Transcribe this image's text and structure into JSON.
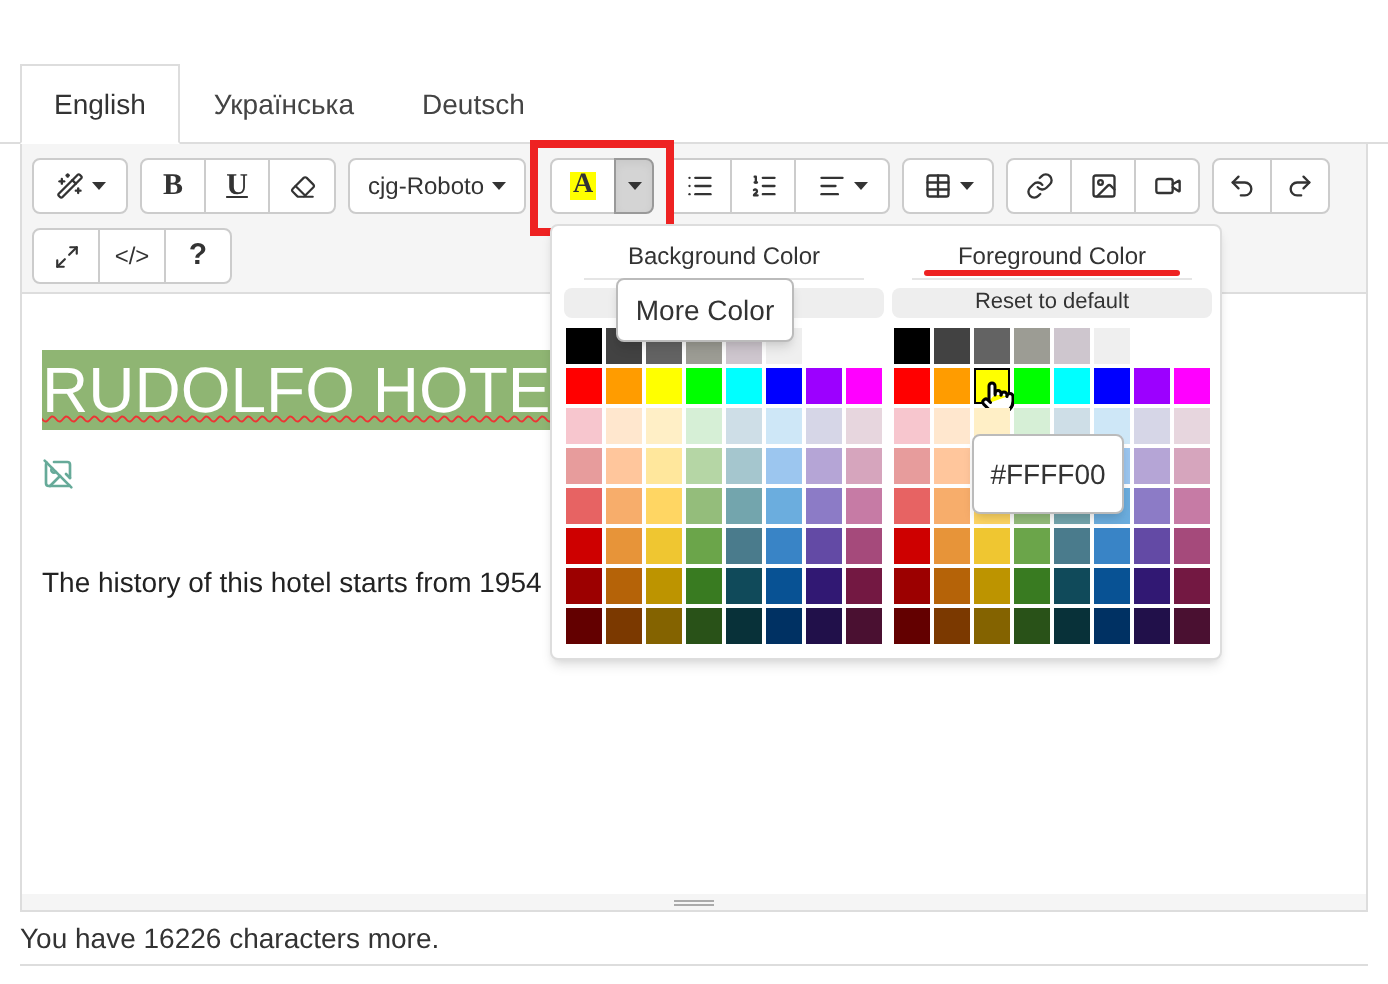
{
  "tabs": [
    {
      "label": "English",
      "selected": true
    },
    {
      "label": "Українська",
      "selected": false
    },
    {
      "label": "Deutsch",
      "selected": false
    }
  ],
  "toolbar": {
    "bold": "B",
    "underline": "U",
    "font": "cjg-Roboto",
    "color_letter": "A",
    "color_caret_pressed": true,
    "color_button_highlighted": true,
    "code_view": "</>",
    "help": "?"
  },
  "content": {
    "heading": "RUDOLFO HOTE",
    "paragraph": "The history of this hotel starts from 1954"
  },
  "color_picker": {
    "columns": [
      {
        "title": "Background Color",
        "annotated": false,
        "rows": [
          [
            {
              "color": "#000000",
              "hovered": false
            },
            {
              "color": "#424242",
              "hovered": false
            },
            {
              "color": "#636363",
              "hovered": false
            },
            {
              "color": "#9c9c94",
              "hovered": false
            },
            {
              "color": "#cec6ce",
              "hovered": false
            },
            {
              "color": "#efefef",
              "hovered": false
            },
            null,
            null
          ],
          [
            {
              "color": "#ff0000",
              "hovered": false
            },
            {
              "color": "#ff9c00",
              "hovered": false
            },
            {
              "color": "#ffff00",
              "hovered": false
            },
            {
              "color": "#00ff00",
              "hovered": false
            },
            {
              "color": "#00ffff",
              "hovered": false
            },
            {
              "color": "#0000ff",
              "hovered": false
            },
            {
              "color": "#9c00ff",
              "hovered": false
            },
            {
              "color": "#ff00ff",
              "hovered": false
            }
          ],
          [
            {
              "color": "#f7c6ce",
              "hovered": false
            },
            {
              "color": "#ffe7ce",
              "hovered": false
            },
            {
              "color": "#ffefc6",
              "hovered": false
            },
            {
              "color": "#d6efd6",
              "hovered": false
            },
            {
              "color": "#cedee7",
              "hovered": false
            },
            {
              "color": "#cee7f7",
              "hovered": false
            },
            {
              "color": "#d6d6e7",
              "hovered": false
            },
            {
              "color": "#e7d6de",
              "hovered": false
            }
          ],
          [
            {
              "color": "#e79c9c",
              "hovered": false
            },
            {
              "color": "#ffc69c",
              "hovered": false
            },
            {
              "color": "#ffe79c",
              "hovered": false
            },
            {
              "color": "#b5d6a5",
              "hovered": false
            },
            {
              "color": "#a5c6ce",
              "hovered": false
            },
            {
              "color": "#9cc6ef",
              "hovered": false
            },
            {
              "color": "#b5a5d6",
              "hovered": false
            },
            {
              "color": "#d6a5bd",
              "hovered": false
            }
          ],
          [
            {
              "color": "#e76363",
              "hovered": false
            },
            {
              "color": "#f7ad6b",
              "hovered": false
            },
            {
              "color": "#ffd663",
              "hovered": false
            },
            {
              "color": "#94bd7b",
              "hovered": false
            },
            {
              "color": "#73a5ad",
              "hovered": false
            },
            {
              "color": "#6badde",
              "hovered": false
            },
            {
              "color": "#8c7bc6",
              "hovered": false
            },
            {
              "color": "#c67ba5",
              "hovered": false
            }
          ],
          [
            {
              "color": "#ce0000",
              "hovered": false
            },
            {
              "color": "#e79439",
              "hovered": false
            },
            {
              "color": "#efc631",
              "hovered": false
            },
            {
              "color": "#6ba54a",
              "hovered": false
            },
            {
              "color": "#4a7b8c",
              "hovered": false
            },
            {
              "color": "#3984c6",
              "hovered": false
            },
            {
              "color": "#634aa5",
              "hovered": false
            },
            {
              "color": "#a54a7b",
              "hovered": false
            }
          ],
          [
            {
              "color": "#9c0000",
              "hovered": false
            },
            {
              "color": "#b56308",
              "hovered": false
            },
            {
              "color": "#bd9400",
              "hovered": false
            },
            {
              "color": "#397b21",
              "hovered": false
            },
            {
              "color": "#104a5a",
              "hovered": false
            },
            {
              "color": "#085294",
              "hovered": false
            },
            {
              "color": "#311873",
              "hovered": false
            },
            {
              "color": "#731842",
              "hovered": false
            }
          ],
          [
            {
              "color": "#630000",
              "hovered": false
            },
            {
              "color": "#7b3900",
              "hovered": false
            },
            {
              "color": "#846300",
              "hovered": false
            },
            {
              "color": "#295218",
              "hovered": false
            },
            {
              "color": "#083139",
              "hovered": false
            },
            {
              "color": "#003163",
              "hovered": false
            },
            {
              "color": "#21104a",
              "hovered": false
            },
            {
              "color": "#4a1031",
              "hovered": false
            }
          ]
        ]
      },
      {
        "title": "Foreground Color",
        "annotated": true,
        "reset_label": "Reset to default",
        "rows": [
          [
            {
              "color": "#000000",
              "hovered": false
            },
            {
              "color": "#424242",
              "hovered": false
            },
            {
              "color": "#636363",
              "hovered": false
            },
            {
              "color": "#9c9c94",
              "hovered": false
            },
            {
              "color": "#cec6ce",
              "hovered": false
            },
            {
              "color": "#efefef",
              "hovered": false
            },
            null,
            null
          ],
          [
            {
              "color": "#ff0000",
              "hovered": false
            },
            {
              "color": "#ff9c00",
              "hovered": false
            },
            {
              "color": "#ffff00",
              "hovered": true
            },
            {
              "color": "#00ff00",
              "hovered": false
            },
            {
              "color": "#00ffff",
              "hovered": false
            },
            {
              "color": "#0000ff",
              "hovered": false
            },
            {
              "color": "#9c00ff",
              "hovered": false
            },
            {
              "color": "#ff00ff",
              "hovered": false
            }
          ],
          [
            {
              "color": "#f7c6ce",
              "hovered": false
            },
            {
              "color": "#ffe7ce",
              "hovered": false
            },
            {
              "color": "#ffefc6",
              "hovered": false
            },
            {
              "color": "#d6efd6",
              "hovered": false
            },
            {
              "color": "#cedee7",
              "hovered": false
            },
            {
              "color": "#cee7f7",
              "hovered": false
            },
            {
              "color": "#d6d6e7",
              "hovered": false
            },
            {
              "color": "#e7d6de",
              "hovered": false
            }
          ],
          [
            {
              "color": "#e79c9c",
              "hovered": false
            },
            {
              "color": "#ffc69c",
              "hovered": false
            },
            null,
            null,
            null,
            {
              "color": "#9cc6ef",
              "hovered": false
            },
            {
              "color": "#b5a5d6",
              "hovered": false
            },
            {
              "color": "#d6a5bd",
              "hovered": false
            }
          ],
          [
            {
              "color": "#e76363",
              "hovered": false
            },
            {
              "color": "#f7ad6b",
              "hovered": false
            },
            {
              "color": "#ffd663",
              "hovered": false
            },
            {
              "color": "#94bd7b",
              "hovered": false
            },
            {
              "color": "#73a5ad",
              "hovered": false
            },
            {
              "color": "#6badde",
              "hovered": false
            },
            {
              "color": "#8c7bc6",
              "hovered": false
            },
            {
              "color": "#c67ba5",
              "hovered": false
            }
          ],
          [
            {
              "color": "#ce0000",
              "hovered": false
            },
            {
              "color": "#e79439",
              "hovered": false
            },
            {
              "color": "#efc631",
              "hovered": false
            },
            {
              "color": "#6ba54a",
              "hovered": false
            },
            {
              "color": "#4a7b8c",
              "hovered": false
            },
            {
              "color": "#3984c6",
              "hovered": false
            },
            {
              "color": "#634aa5",
              "hovered": false
            },
            {
              "color": "#a54a7b",
              "hovered": false
            }
          ],
          [
            {
              "color": "#9c0000",
              "hovered": false
            },
            {
              "color": "#b56308",
              "hovered": false
            },
            {
              "color": "#bd9400",
              "hovered": false
            },
            {
              "color": "#397b21",
              "hovered": false
            },
            {
              "color": "#104a5a",
              "hovered": false
            },
            {
              "color": "#085294",
              "hovered": false
            },
            {
              "color": "#311873",
              "hovered": false
            },
            {
              "color": "#731842",
              "hovered": false
            }
          ],
          [
            {
              "color": "#630000",
              "hovered": false
            },
            {
              "color": "#7b3900",
              "hovered": false
            },
            {
              "color": "#846300",
              "hovered": false
            },
            {
              "color": "#295218",
              "hovered": false
            },
            {
              "color": "#083139",
              "hovered": false
            },
            {
              "color": "#003163",
              "hovered": false
            },
            {
              "color": "#21104a",
              "hovered": false
            },
            {
              "color": "#4a1031",
              "hovered": false
            }
          ]
        ]
      }
    ],
    "more_color_tooltip": "More Color",
    "swatch_tooltip": "#FFFF00"
  },
  "footer": "You have 16226 characters more."
}
